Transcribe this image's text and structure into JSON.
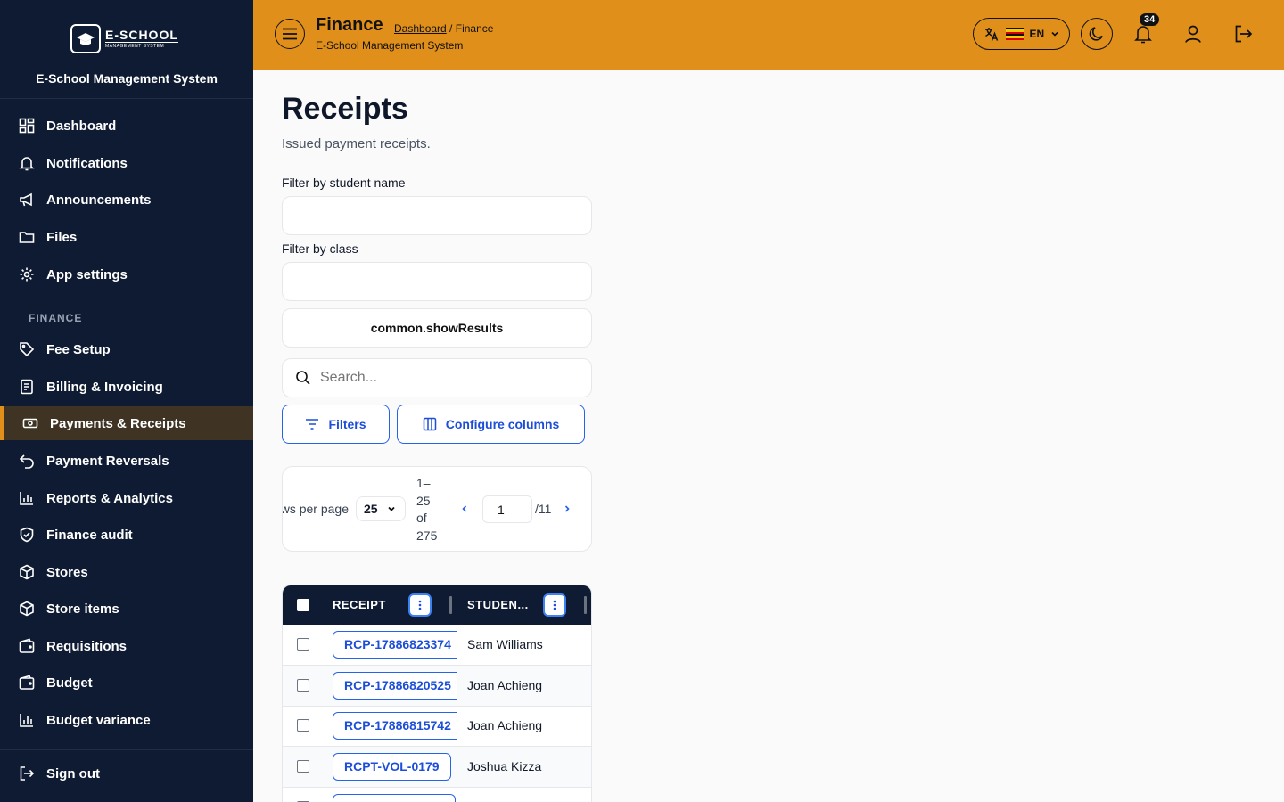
{
  "sidebar": {
    "logo_title": "E-SCHOOL",
    "logo_subtitle": "MANAGEMENT SYSTEM",
    "system_name": "E-School Management System",
    "items": [
      {
        "label": "Dashboard",
        "icon": "grid-icon"
      },
      {
        "label": "Notifications",
        "icon": "bell-icon"
      },
      {
        "label": "Announcements",
        "icon": "megaphone-icon"
      },
      {
        "label": "Files",
        "icon": "folder-icon"
      },
      {
        "label": "App settings",
        "icon": "gear-icon"
      }
    ],
    "section_finance": "FINANCE",
    "finance_items": [
      {
        "label": "Fee Setup",
        "icon": "tag-icon"
      },
      {
        "label": "Billing & Invoicing",
        "icon": "invoice-icon"
      },
      {
        "label": "Payments & Receipts",
        "icon": "cash-icon",
        "active": true
      },
      {
        "label": "Payment Reversals",
        "icon": "undo-icon"
      },
      {
        "label": "Reports & Analytics",
        "icon": "bar-chart-icon"
      },
      {
        "label": "Finance audit",
        "icon": "shield-check-icon"
      },
      {
        "label": "Stores",
        "icon": "box-icon"
      },
      {
        "label": "Store items",
        "icon": "box-icon"
      },
      {
        "label": "Requisitions",
        "icon": "wallet-icon"
      },
      {
        "label": "Budget",
        "icon": "wallet-icon"
      },
      {
        "label": "Budget variance",
        "icon": "bar-chart-icon"
      }
    ],
    "sign_out": "Sign out"
  },
  "topbar": {
    "title": "Finance",
    "breadcrumb_link": "Dashboard",
    "breadcrumb_sep": " / ",
    "breadcrumb_current": "Finance",
    "subtitle": "E-School Management System",
    "language": "EN",
    "notification_count": "34",
    "accent_color": "#e08f1a"
  },
  "main": {
    "title": "Receipts",
    "subtitle": "Issued payment receipts.",
    "filter_student_label": "Filter by student name",
    "filter_class_label": "Filter by class",
    "show_results": "common.showResults",
    "search_placeholder": "Search...",
    "filters_button": "Filters",
    "configure_columns_button": "Configure columns"
  },
  "pagination": {
    "rows_per_page_label": "Rows per page",
    "rows_per_page_value": "25",
    "range_lines": [
      "1–",
      "25",
      "of",
      "275"
    ],
    "current_page": "1",
    "total_pages": "/11"
  },
  "table": {
    "columns": [
      "RECEIPT",
      "STUDEN..."
    ],
    "rows": [
      {
        "receipt": "RCP-17886823374",
        "student": "Sam Williams"
      },
      {
        "receipt": "RCP-17886820525",
        "student": "Joan Achieng"
      },
      {
        "receipt": "RCP-17886815742",
        "student": "Joan Achieng"
      },
      {
        "receipt": "RCPT-VOL-0179",
        "student": "Joshua Kizza"
      },
      {
        "receipt": "",
        "student": ""
      }
    ]
  }
}
